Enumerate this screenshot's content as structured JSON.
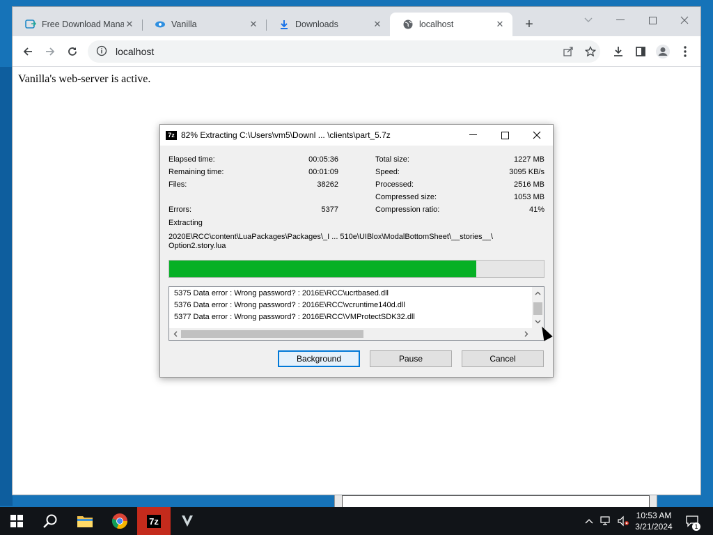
{
  "browser": {
    "tabs": [
      {
        "label": "Free Download Manager",
        "icon": "fdm-icon"
      },
      {
        "label": "Vanilla",
        "icon": "vanilla-icon"
      },
      {
        "label": "Downloads",
        "icon": "download-icon"
      },
      {
        "label": "localhost",
        "icon": "globe-icon",
        "active": true
      }
    ],
    "url": "localhost",
    "page_text": "Vanilla's web-server is active."
  },
  "dialog": {
    "title": "82% Extracting C:\\Users\\vm5\\Downl ... \\clients\\part_5.7z",
    "icon_label": "7z",
    "progress_percent": 82,
    "stats_left": [
      {
        "label": "Elapsed time:",
        "value": "00:05:36"
      },
      {
        "label": "Remaining time:",
        "value": "00:01:09"
      },
      {
        "label": "Files:",
        "value": "38262"
      },
      {
        "label": "Errors:",
        "value": "5377"
      }
    ],
    "stats_right": [
      {
        "label": "Total size:",
        "value": "1227 MB"
      },
      {
        "label": "Speed:",
        "value": "3095 KB/s"
      },
      {
        "label": "Processed:",
        "value": "2516 MB"
      },
      {
        "label": "Compressed size:",
        "value": "1053 MB"
      },
      {
        "label": "Compression ratio:",
        "value": "41%"
      }
    ],
    "action": "Extracting",
    "current_file_line1": "2020E\\RCC\\content\\LuaPackages\\Packages\\_I ... 510e\\UIBlox\\ModalBottomSheet\\__stories__\\",
    "current_file_line2": "Option2.story.lua",
    "log": [
      "5375   Data error : Wrong password? : 2016E\\RCC\\ucrtbased.dll",
      "5376   Data error : Wrong password? : 2016E\\RCC\\vcruntime140d.dll",
      "5377   Data error : Wrong password? : 2016E\\RCC\\VMProtectSDK32.dll"
    ],
    "buttons": {
      "background": "Background",
      "pause": "Pause",
      "cancel": "Cancel"
    }
  },
  "taskbar": {
    "apps": [
      "start-icon",
      "search-icon",
      "file-explorer-icon",
      "chrome-icon",
      "7zip-icon",
      "vanilla-icon"
    ],
    "seven_zip_label": "7z",
    "time": "10:53 AM",
    "date": "3/21/2024",
    "notification_count": "1"
  },
  "colors": {
    "progress_fill": "#06b025",
    "accent": "#0078d7",
    "taskbar": "#111418"
  }
}
